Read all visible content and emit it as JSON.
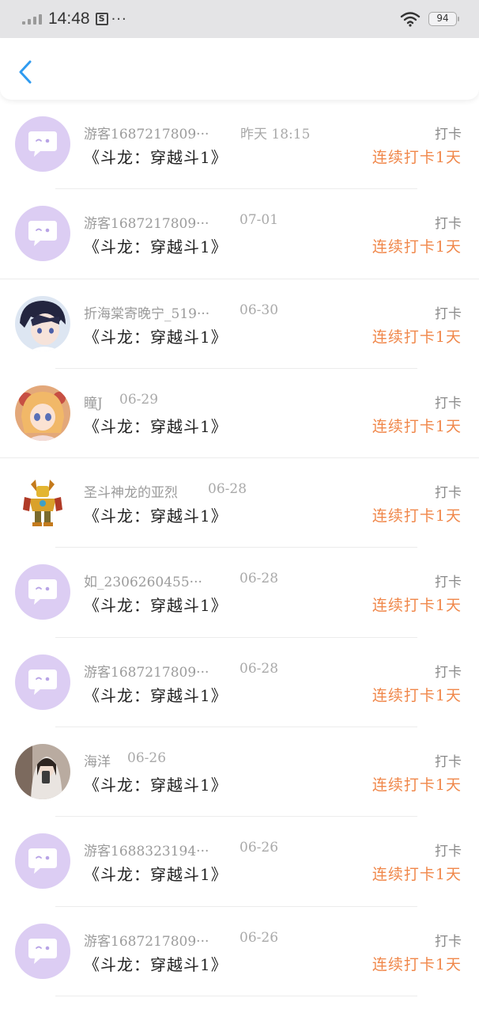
{
  "status_bar": {
    "time": "14:48",
    "dots": "···",
    "battery": "94",
    "icons": [
      "signal-icon",
      "app-notification-icon",
      "wifi-icon",
      "battery-icon"
    ]
  },
  "header": {
    "back_icon": "chevron-left-icon",
    "accent_color": "#2f9bf0"
  },
  "colors": {
    "streak": "#f0874a",
    "default_avatar_bg": "#dccdf3"
  },
  "items": [
    {
      "username": "游客1687217809···",
      "time": "昨天 18:15",
      "title": "《斗龙：穿越斗1》",
      "action": "打卡",
      "streak": "连续打卡1天",
      "avatar": "default-avatar"
    },
    {
      "username": "游客1687217809···",
      "time": "07-01",
      "title": "《斗龙：穿越斗1》",
      "action": "打卡",
      "streak": "连续打卡1天",
      "avatar": "default-avatar"
    },
    {
      "username": "折海棠寄晚宁_519···",
      "time": "06-30",
      "title": "《斗龙：穿越斗1》",
      "action": "打卡",
      "streak": "连续打卡1天",
      "avatar": "anime-boy-avatar"
    },
    {
      "username": "瞳J",
      "time": "06-29",
      "title": "《斗龙：穿越斗1》",
      "action": "打卡",
      "streak": "连续打卡1天",
      "avatar": "anime-girl-avatar"
    },
    {
      "username": "圣斗神龙的亚烈",
      "time": "06-28",
      "title": "《斗龙：穿越斗1》",
      "action": "打卡",
      "streak": "连续打卡1天",
      "avatar": "robot-avatar"
    },
    {
      "username": "如_2306260455···",
      "time": "06-28",
      "title": "《斗龙：穿越斗1》",
      "action": "打卡",
      "streak": "连续打卡1天",
      "avatar": "default-avatar"
    },
    {
      "username": "游客1687217809···",
      "time": "06-28",
      "title": "《斗龙：穿越斗1》",
      "action": "打卡",
      "streak": "连续打卡1天",
      "avatar": "default-avatar"
    },
    {
      "username": "海洋",
      "time": "06-26",
      "title": "《斗龙：穿越斗1》",
      "action": "打卡",
      "streak": "连续打卡1天",
      "avatar": "photo-girl-avatar"
    },
    {
      "username": "游客1688323194···",
      "time": "06-26",
      "title": "《斗龙：穿越斗1》",
      "action": "打卡",
      "streak": "连续打卡1天",
      "avatar": "default-avatar"
    },
    {
      "username": "游客1687217809···",
      "time": "06-26",
      "title": "《斗龙：穿越斗1》",
      "action": "打卡",
      "streak": "连续打卡1天",
      "avatar": "default-avatar"
    }
  ]
}
